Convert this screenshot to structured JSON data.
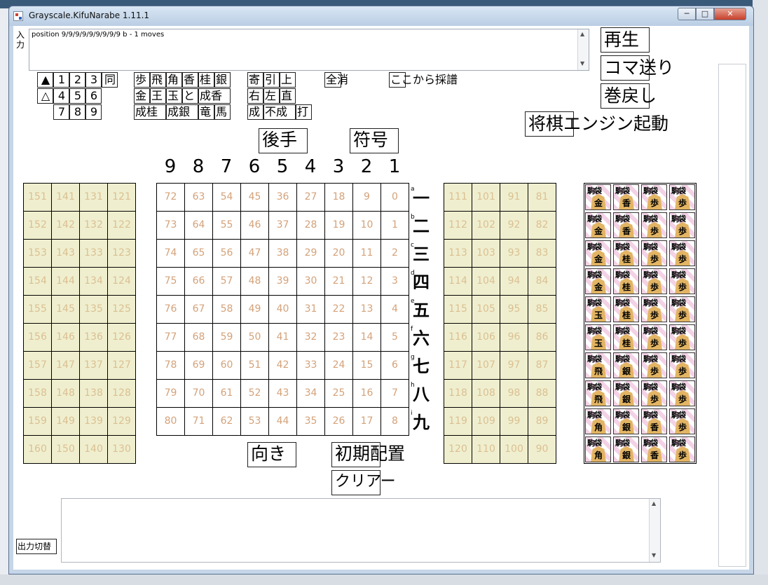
{
  "window": {
    "title": "Grayscale.KifuNarabe 1.11.1",
    "min": "─",
    "max": "□",
    "close": "✕"
  },
  "input": {
    "label": "入力",
    "value": "position 9/9/9/9/9/9/9/9/9 b - 1 moves"
  },
  "buttons": {
    "play": "再生",
    "step": "コマ送り",
    "rewind": "巻戻し",
    "engine": "将棋エンジン起動",
    "gote": "後手",
    "notation": "符号",
    "orientation": "向き",
    "init": "初期配置",
    "clear": "クリアー",
    "output_toggle": "出力切替",
    "clearall": "全消",
    "record_from_here": "ここから採譜"
  },
  "turn_pad": {
    "rows": [
      [
        "▲",
        "1",
        "2",
        "3",
        "同"
      ],
      [
        "△",
        "4",
        "5",
        "6"
      ],
      [
        "",
        "7",
        "8",
        "9"
      ]
    ]
  },
  "piece_pad": {
    "rows": [
      [
        "歩",
        "飛",
        "角",
        "香",
        "桂",
        "銀"
      ],
      [
        "金",
        "王",
        "玉",
        "と",
        "成香"
      ],
      [
        "成桂",
        "成銀",
        "竜",
        "馬"
      ]
    ]
  },
  "move_pad": {
    "rows": [
      [
        "寄",
        "引",
        "上"
      ],
      [
        "右",
        "左",
        "直"
      ],
      [
        "成",
        "不成",
        "打"
      ]
    ]
  },
  "files": [
    "9",
    "8",
    "7",
    "6",
    "5",
    "4",
    "3",
    "2",
    "1"
  ],
  "ranks_kanji": [
    "一",
    "二",
    "三",
    "四",
    "五",
    "六",
    "七",
    "八",
    "九"
  ],
  "ranks_latin": [
    "a",
    "b",
    "c",
    "d",
    "e",
    "f",
    "g",
    "h",
    "i"
  ],
  "board": [
    [
      "72",
      "63",
      "54",
      "45",
      "36",
      "27",
      "18",
      "9",
      "0"
    ],
    [
      "73",
      "64",
      "55",
      "46",
      "37",
      "28",
      "19",
      "10",
      "1"
    ],
    [
      "74",
      "65",
      "56",
      "47",
      "38",
      "29",
      "20",
      "11",
      "2"
    ],
    [
      "75",
      "66",
      "57",
      "48",
      "39",
      "30",
      "21",
      "12",
      "3"
    ],
    [
      "76",
      "67",
      "58",
      "49",
      "40",
      "31",
      "22",
      "13",
      "4"
    ],
    [
      "77",
      "68",
      "59",
      "50",
      "41",
      "32",
      "23",
      "14",
      "5"
    ],
    [
      "78",
      "69",
      "60",
      "51",
      "42",
      "33",
      "24",
      "15",
      "6"
    ],
    [
      "79",
      "70",
      "61",
      "52",
      "43",
      "34",
      "25",
      "16",
      "7"
    ],
    [
      "80",
      "71",
      "62",
      "53",
      "44",
      "35",
      "26",
      "17",
      "8"
    ]
  ],
  "left_stand": [
    [
      "151",
      "141",
      "131",
      "121"
    ],
    [
      "152",
      "142",
      "132",
      "122"
    ],
    [
      "153",
      "143",
      "133",
      "123"
    ],
    [
      "154",
      "144",
      "134",
      "124"
    ],
    [
      "155",
      "145",
      "135",
      "125"
    ],
    [
      "156",
      "146",
      "136",
      "126"
    ],
    [
      "157",
      "147",
      "137",
      "127"
    ],
    [
      "158",
      "148",
      "138",
      "128"
    ],
    [
      "159",
      "149",
      "139",
      "129"
    ],
    [
      "160",
      "150",
      "140",
      "130"
    ]
  ],
  "right_stand": [
    [
      "111",
      "101",
      "91",
      "81"
    ],
    [
      "112",
      "102",
      "92",
      "82"
    ],
    [
      "113",
      "103",
      "93",
      "83"
    ],
    [
      "114",
      "104",
      "94",
      "84"
    ],
    [
      "115",
      "105",
      "95",
      "85"
    ],
    [
      "116",
      "106",
      "96",
      "86"
    ],
    [
      "117",
      "107",
      "97",
      "87"
    ],
    [
      "118",
      "108",
      "98",
      "88"
    ],
    [
      "119",
      "109",
      "99",
      "89"
    ],
    [
      "120",
      "110",
      "100",
      "90"
    ]
  ],
  "bags": {
    "label": "駒袋",
    "rows": [
      [
        "金",
        "香",
        "歩",
        "歩"
      ],
      [
        "金",
        "香",
        "歩",
        "歩"
      ],
      [
        "金",
        "桂",
        "歩",
        "歩"
      ],
      [
        "金",
        "桂",
        "歩",
        "歩"
      ],
      [
        "玉",
        "桂",
        "歩",
        "歩"
      ],
      [
        "玉",
        "桂",
        "歩",
        "歩"
      ],
      [
        "飛",
        "銀",
        "歩",
        "歩"
      ],
      [
        "飛",
        "銀",
        "歩",
        "歩"
      ],
      [
        "角",
        "銀",
        "香",
        "歩"
      ],
      [
        "角",
        "銀",
        "香",
        "歩"
      ]
    ]
  },
  "colors": {
    "board_label": "#d4a27a",
    "stand_bg": "#efefcf",
    "bag_stripe": "#f3d2e6",
    "piece": "#e2b463"
  }
}
